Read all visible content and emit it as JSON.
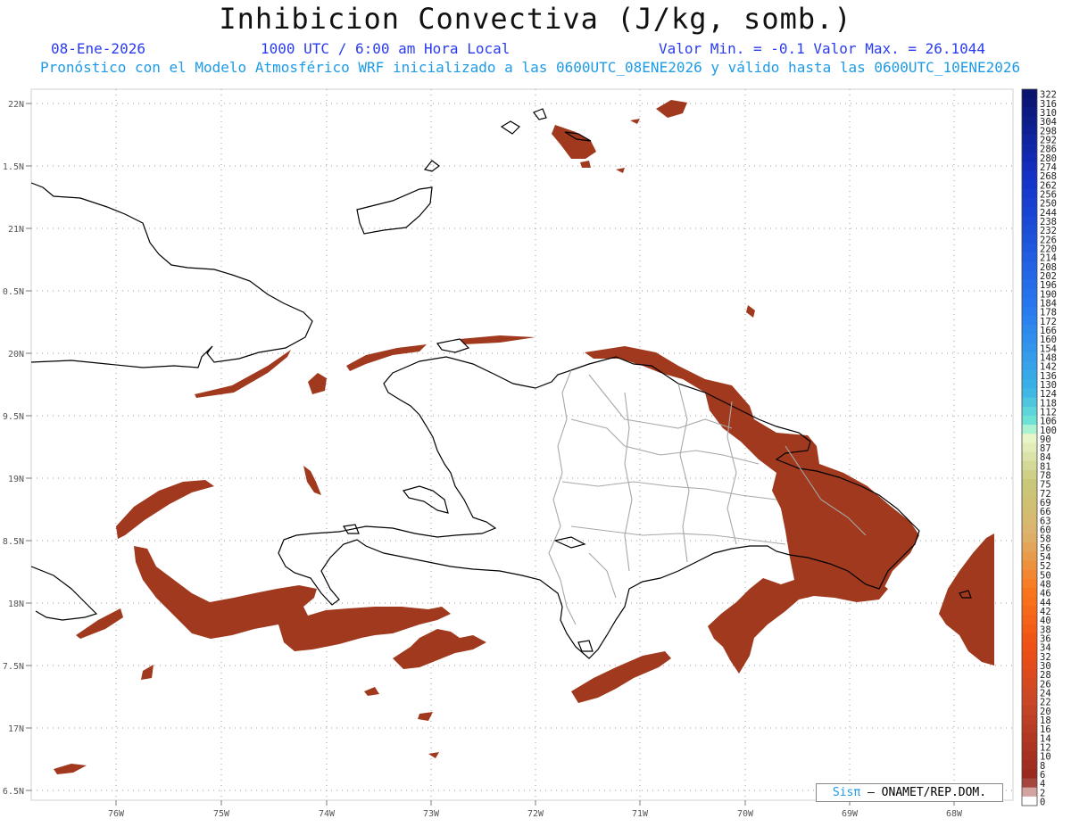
{
  "header": {
    "title": "Inhibicion Convectiva (J/kg, somb.)",
    "date": "08-Ene-2026",
    "time": "1000 UTC / 6:00 am Hora Local",
    "minmax": "Valor Min. = -0.1  Valor Max. = 26.1044",
    "subtitle": "Pronóstico con el Modelo Atmosférico WRF inicializado a las 0600UTC_08ENE2026 y válido hasta las  0600UTC_10ENE2026"
  },
  "map": {
    "lat_labels": [
      "22N",
      "1.5N",
      "21N",
      "0.5N",
      "20N",
      "9.5N",
      "19N",
      "8.5N",
      "18N",
      "7.5N",
      "17N",
      "6.5N"
    ],
    "lon_labels": [
      "76W",
      "75W",
      "74W",
      "73W",
      "72W",
      "71W",
      "70W",
      "69W",
      "68W"
    ],
    "shading_color": "#a0391e",
    "coast_color": "#000000",
    "border_color": "#a8a8a8"
  },
  "colorbar": {
    "labels": [
      "322",
      "316",
      "310",
      "304",
      "298",
      "292",
      "286",
      "280",
      "274",
      "268",
      "262",
      "256",
      "250",
      "244",
      "238",
      "232",
      "226",
      "220",
      "214",
      "208",
      "202",
      "196",
      "190",
      "184",
      "178",
      "172",
      "166",
      "160",
      "154",
      "148",
      "142",
      "136",
      "130",
      "124",
      "118",
      "112",
      "106",
      "100",
      "90",
      "87",
      "84",
      "81",
      "78",
      "75",
      "72",
      "69",
      "66",
      "63",
      "60",
      "58",
      "56",
      "54",
      "52",
      "50",
      "48",
      "46",
      "44",
      "42",
      "40",
      "38",
      "36",
      "34",
      "32",
      "30",
      "28",
      "26",
      "24",
      "22",
      "20",
      "18",
      "16",
      "14",
      "12",
      "10",
      "8",
      "6",
      "4",
      "2",
      "0"
    ]
  },
  "credit": {
    "logo": "Sisπ",
    "text": "– ONAMET/REP.DOM."
  }
}
